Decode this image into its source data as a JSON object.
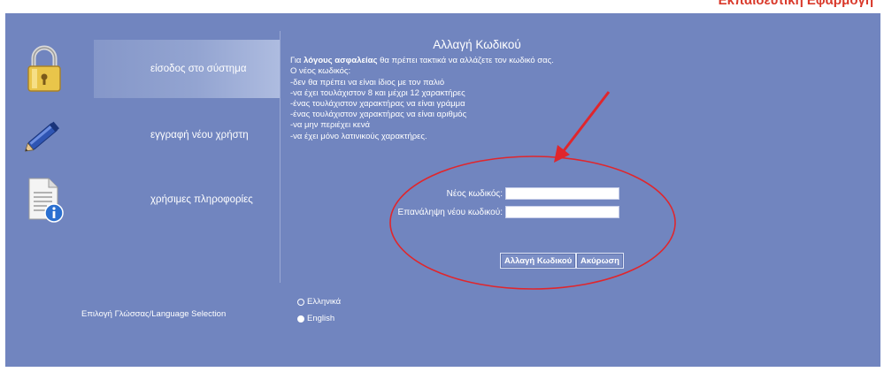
{
  "header": {
    "title": "Εκπαιδευτική Εφαρμογή"
  },
  "sidebar": {
    "items": [
      {
        "label": "είσοδος στο σύστημα",
        "icon": "padlock-icon",
        "active": true
      },
      {
        "label": "εγγραφή νέου χρήστη",
        "icon": "pen-icon",
        "active": false
      },
      {
        "label": "χρήσιμες πληροφορίες",
        "icon": "info-document-icon",
        "active": false
      }
    ]
  },
  "main": {
    "title": "Αλλαγή Κωδικού",
    "intro_prefix": "Για ",
    "intro_bold": "λόγους ασφαλείας",
    "intro_suffix": " θα πρέπει τακτικά να αλλάζετε τον κωδικό σας.",
    "rules_heading": "Ο νέος κωδικός:",
    "rules": [
      "-δεν θα πρέπει να είναι ίδιος με τον παλιό",
      "-να έχει τουλάχιστον 8 και μέχρι 12 χαρακτήρες",
      "-ένας τουλάχιστον χαρακτήρας να είναι γράμμα",
      "-ένας τουλάχιστον χαρακτήρας να είναι αριθμός",
      "-να μην περιέχει κενά",
      "-να έχει μόνο λατινικούς χαρακτήρες."
    ]
  },
  "form": {
    "new_password_label": "Νέος κωδικός:",
    "new_password_value": "",
    "repeat_password_label": "Επανάληψη νέου κωδικού:",
    "repeat_password_value": "",
    "submit_label": "Αλλαγή Κωδικού",
    "cancel_label": "Ακύρωση"
  },
  "language": {
    "label": "Επιλογή Γλώσσας/Language Selection",
    "options": [
      {
        "label": "Ελληνικά",
        "selected": false
      },
      {
        "label": "English",
        "selected": true
      }
    ]
  },
  "colors": {
    "panel": "#7185bf",
    "annotation": "#e0262c",
    "top_title": "#d9392b"
  }
}
